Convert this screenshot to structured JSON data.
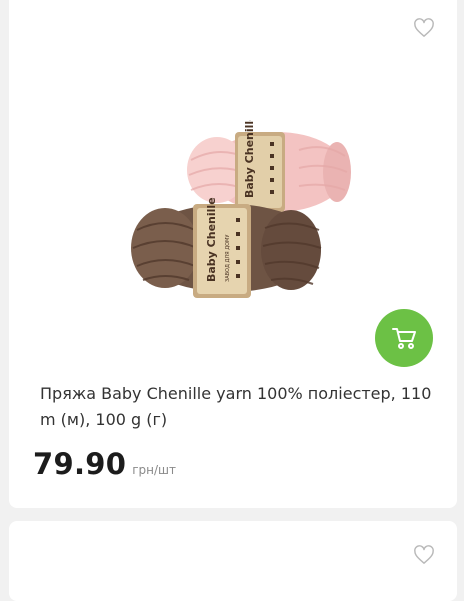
{
  "product": {
    "title": "Пряжа Baby Chenille yarn 100% поліестер, 110 m (м), 100 g (г)",
    "price": "79.90",
    "unit": "грн/шт",
    "brand_label_text": "Baby Chenille",
    "brand_label_subtext": "ЗАВОД ДЛЯ ДОМУ",
    "accent_color": "#6cc145",
    "yarn_colors": [
      "#f5c8c8",
      "#6b5141"
    ]
  },
  "icons": {
    "favorite": "heart-outline-icon",
    "cart": "shopping-cart-icon"
  }
}
